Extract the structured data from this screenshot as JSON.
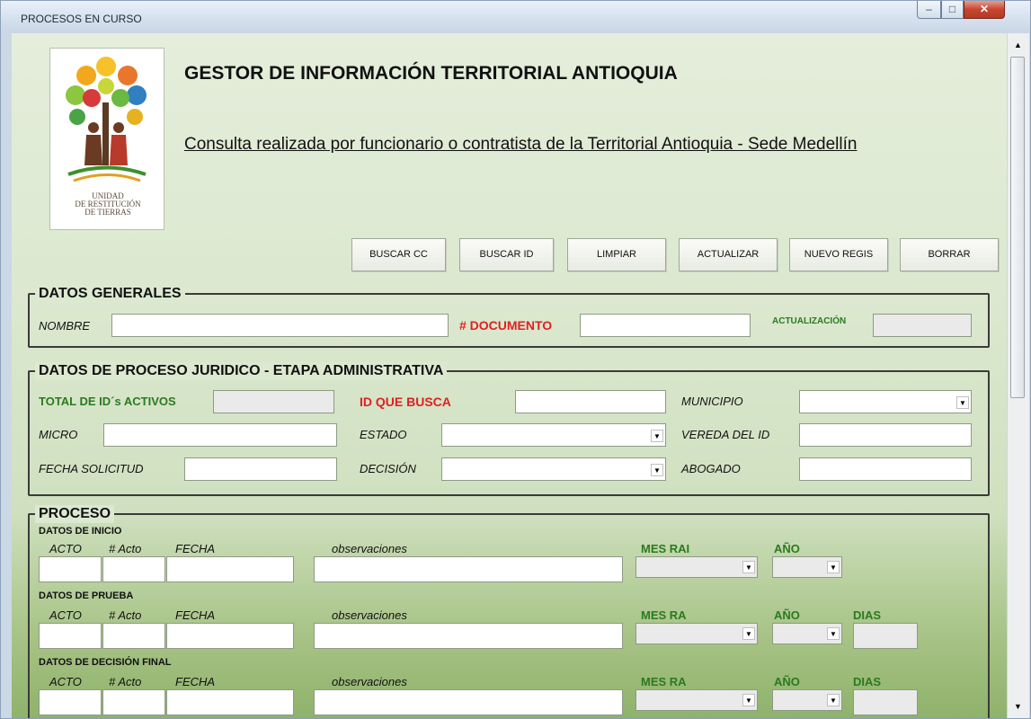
{
  "window": {
    "title": "PROCESOS EN CURSO",
    "min": "–",
    "max": "□",
    "close": "✕"
  },
  "header": {
    "title": "GESTOR DE INFORMACIÓN TERRITORIAL ANTIOQUIA",
    "subtitle": "Consulta realizada por funcionario o contratista de la Territorial Antioquia - Sede Medellín",
    "logo_text": [
      "UNIDAD",
      "DE RESTITUCIÓN",
      "DE TIERRAS"
    ]
  },
  "toolbar": {
    "buscar_cc": "BUSCAR CC",
    "buscar_id": "BUSCAR ID",
    "limpiar": "LIMPIAR",
    "actualizar": "ACTUALIZAR",
    "nuevo": "NUEVO REGIS",
    "borrar": "BORRAR"
  },
  "generales": {
    "legend": "DATOS GENERALES",
    "nombre": "NOMBRE",
    "documento": "# DOCUMENTO",
    "actualizacion": "ACTUALIZACIÓN"
  },
  "juridico": {
    "legend": "DATOS DE PROCESO JURIDICO - ETAPA ADMINISTRATIVA",
    "total_ids": "TOTAL DE ID´s ACTIVOS",
    "id_busca": "ID QUE BUSCA",
    "municipio": "MUNICIPIO",
    "micro": "MICRO",
    "estado": "ESTADO",
    "vereda": "VEREDA DEL ID",
    "fecha_solicitud": "FECHA SOLICITUD",
    "decision": "DECISIÓN",
    "abogado": "ABOGADO"
  },
  "proceso": {
    "legend": "PROCESO",
    "inicio": {
      "title": "DATOS DE INICIO",
      "acto": "ACTO",
      "num": "# Acto",
      "fecha": "FECHA",
      "obs": "observaciones",
      "mes": "MES RAI",
      "anio": "AÑO"
    },
    "prueba": {
      "title": "DATOS DE PRUEBA",
      "acto": "ACTO",
      "num": "# Acto",
      "fecha": "FECHA",
      "obs": "observaciones",
      "mes": "MES RA",
      "anio": "AÑO",
      "dias": "DIAS"
    },
    "final": {
      "title": "DATOS DE DECISIÓN FINAL",
      "acto": "ACTO",
      "num": "# Acto",
      "fecha": "FECHA",
      "obs": "observaciones",
      "mes": "MES RA",
      "anio": "AÑO",
      "dias": "DIAS"
    }
  },
  "icons": {
    "dropdown": "▼",
    "scroll_up": "▲",
    "scroll_down": "▼"
  }
}
